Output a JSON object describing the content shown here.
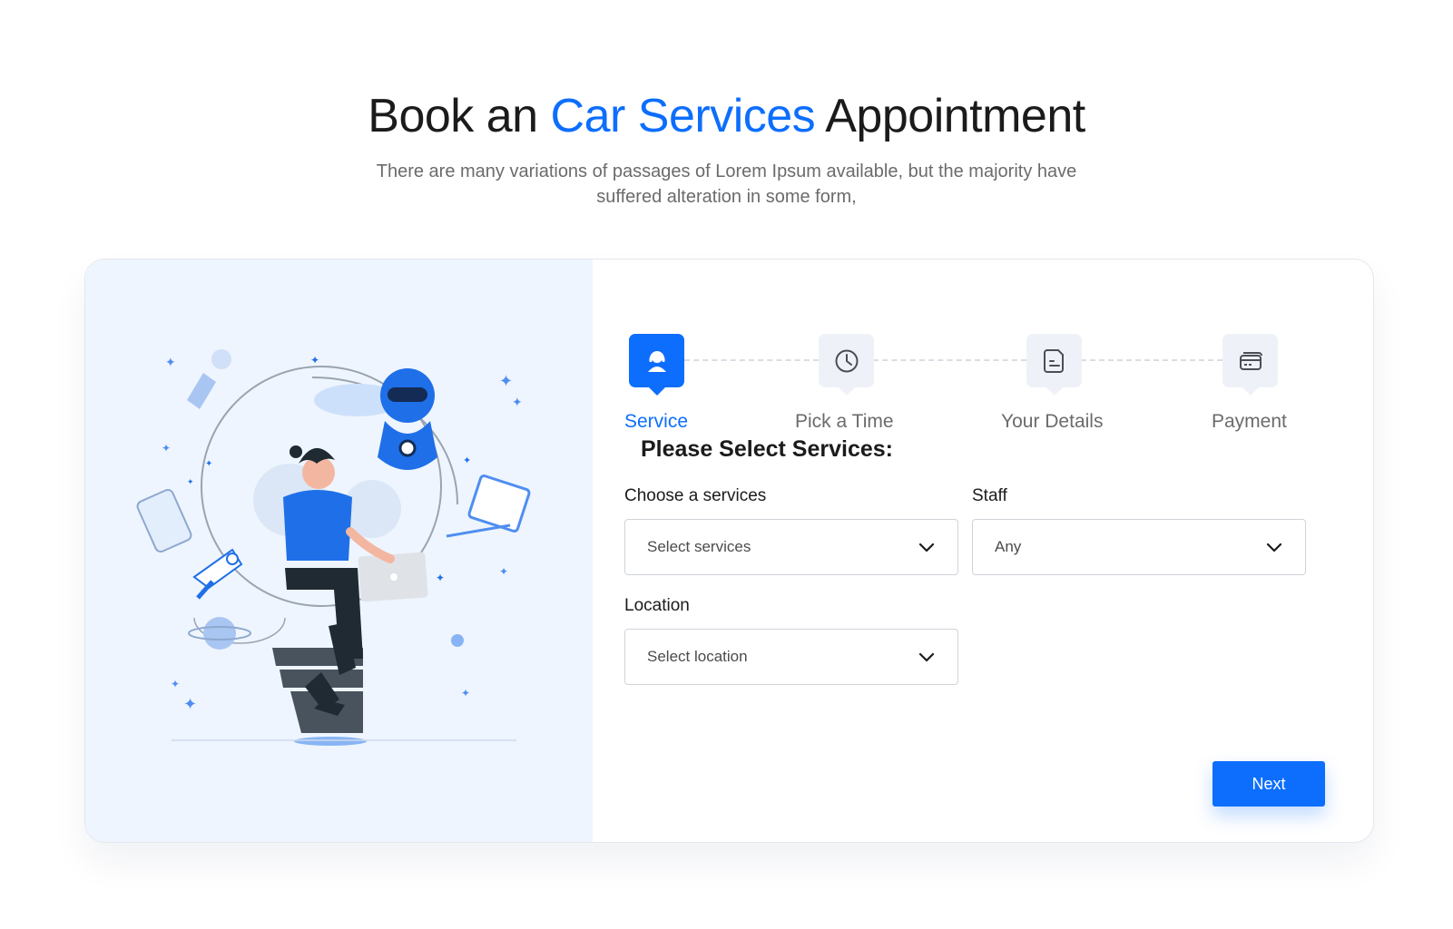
{
  "hero": {
    "title_before": "Book an",
    "title_accent": "Car Services",
    "title_after": "Appointment",
    "subtitle": "There are many variations of passages of Lorem Ipsum available, but the majority have suffered alteration in some form,"
  },
  "steps": [
    {
      "label": "Service",
      "icon": "user-headset-icon",
      "active": true
    },
    {
      "label": "Pick a Time",
      "icon": "clock-icon",
      "active": false
    },
    {
      "label": "Your Details",
      "icon": "document-icon",
      "active": false
    },
    {
      "label": "Payment",
      "icon": "credit-card-icon",
      "active": false
    }
  ],
  "form": {
    "section_title": "Please Select Services:",
    "service": {
      "label": "Choose a services",
      "placeholder": "Select services"
    },
    "staff": {
      "label": "Staff",
      "value": "Any"
    },
    "location": {
      "label": "Location",
      "placeholder": "Select location"
    },
    "next_label": "Next"
  },
  "colors": {
    "accent": "#0d6efd",
    "illustration_bg": "#eef5fe",
    "text": "#1b1b1b",
    "muted": "#6b6b6b"
  }
}
